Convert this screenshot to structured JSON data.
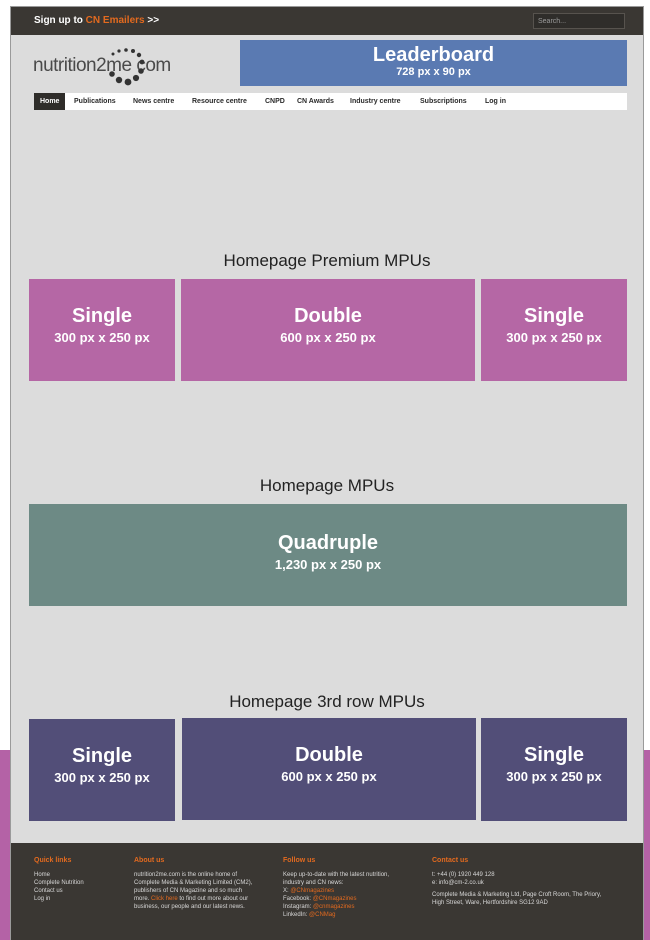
{
  "topbar": {
    "signup_prefix": "Sign up to",
    "signup_accent": "CN Emailers",
    "signup_suffix": ">>",
    "search_placeholder": "Search..."
  },
  "logo": {
    "text": "nutrition2me com"
  },
  "leaderboard": {
    "title": "Leaderboard",
    "size": "728 px x 90 px"
  },
  "nav": {
    "items": [
      {
        "label": "Home",
        "active": true
      },
      {
        "label": "Publications"
      },
      {
        "label": "News centre"
      },
      {
        "label": "Resource centre"
      },
      {
        "label": "CNPD"
      },
      {
        "label": "CN Awards"
      },
      {
        "label": "Industry centre"
      },
      {
        "label": "Subscriptions"
      },
      {
        "label": "Log in"
      }
    ]
  },
  "premium": {
    "title": "Homepage Premium MPUs",
    "ads": [
      {
        "title": "Single",
        "size": "300 px x 250 px"
      },
      {
        "title": "Double",
        "size": "600 px x 250 px"
      },
      {
        "title": "Single",
        "size": "300 px x 250 px"
      }
    ]
  },
  "mpus": {
    "title": "Homepage MPUs",
    "ads": [
      {
        "title": "Quadruple",
        "size": "1,230 px x 250 px"
      }
    ]
  },
  "third_row": {
    "title": "Homepage 3rd row MPUs",
    "ads": [
      {
        "title": "Single",
        "size": "300 px x 250 px"
      },
      {
        "title": "Double",
        "size": "600 px x 250 px"
      },
      {
        "title": "Single",
        "size": "300 px x 250 px"
      }
    ]
  },
  "footer": {
    "quick_links": {
      "heading": "Quick links",
      "items": [
        "Home",
        "Complete Nutrition",
        "Contact us",
        "Log in"
      ]
    },
    "about": {
      "heading": "About us",
      "line1": "nutrition2me.com is the online home of",
      "line2": "Complete Media & Marketing Limited (CM2),",
      "line3": "publishers of CN Magazine and so much",
      "line4_pre": "more.",
      "line4_link": "Click here",
      "line4_post": "to find out more about our",
      "line5": "business, our people and our latest news."
    },
    "follow": {
      "heading": "Follow us",
      "line1": "Keep up-to-date with the latest nutrition,",
      "line2": "industry and CN news:",
      "x_label": "X:",
      "x_handle": "@CNmagazines",
      "facebook_label": "Facebook:",
      "facebook_handle": "@CNmagazines",
      "instagram_label": "Instagram:",
      "instagram_handle": "@cnmagazines",
      "linkedin_label": "LinkedIn:",
      "linkedin_handle": "@CNMag"
    },
    "contact": {
      "heading": "Contact us",
      "phone": "t: +44 (0) 1920 449 128",
      "email": "e: info@cm-2.co.uk",
      "address1": "Complete Media & Marketing Ltd, Page Croft Room, The Priory,",
      "address2": "High Street, Ware, Hertfordshire SG12 9AD"
    }
  },
  "colors": {
    "accent": "#e36a1f",
    "leaderboard": "#5a7ab2",
    "premium_mpu": "#b567a5",
    "quadruple_mpu": "#6d8a85",
    "third_row_mpu": "#524e78",
    "dark_bar": "#3a3733"
  }
}
